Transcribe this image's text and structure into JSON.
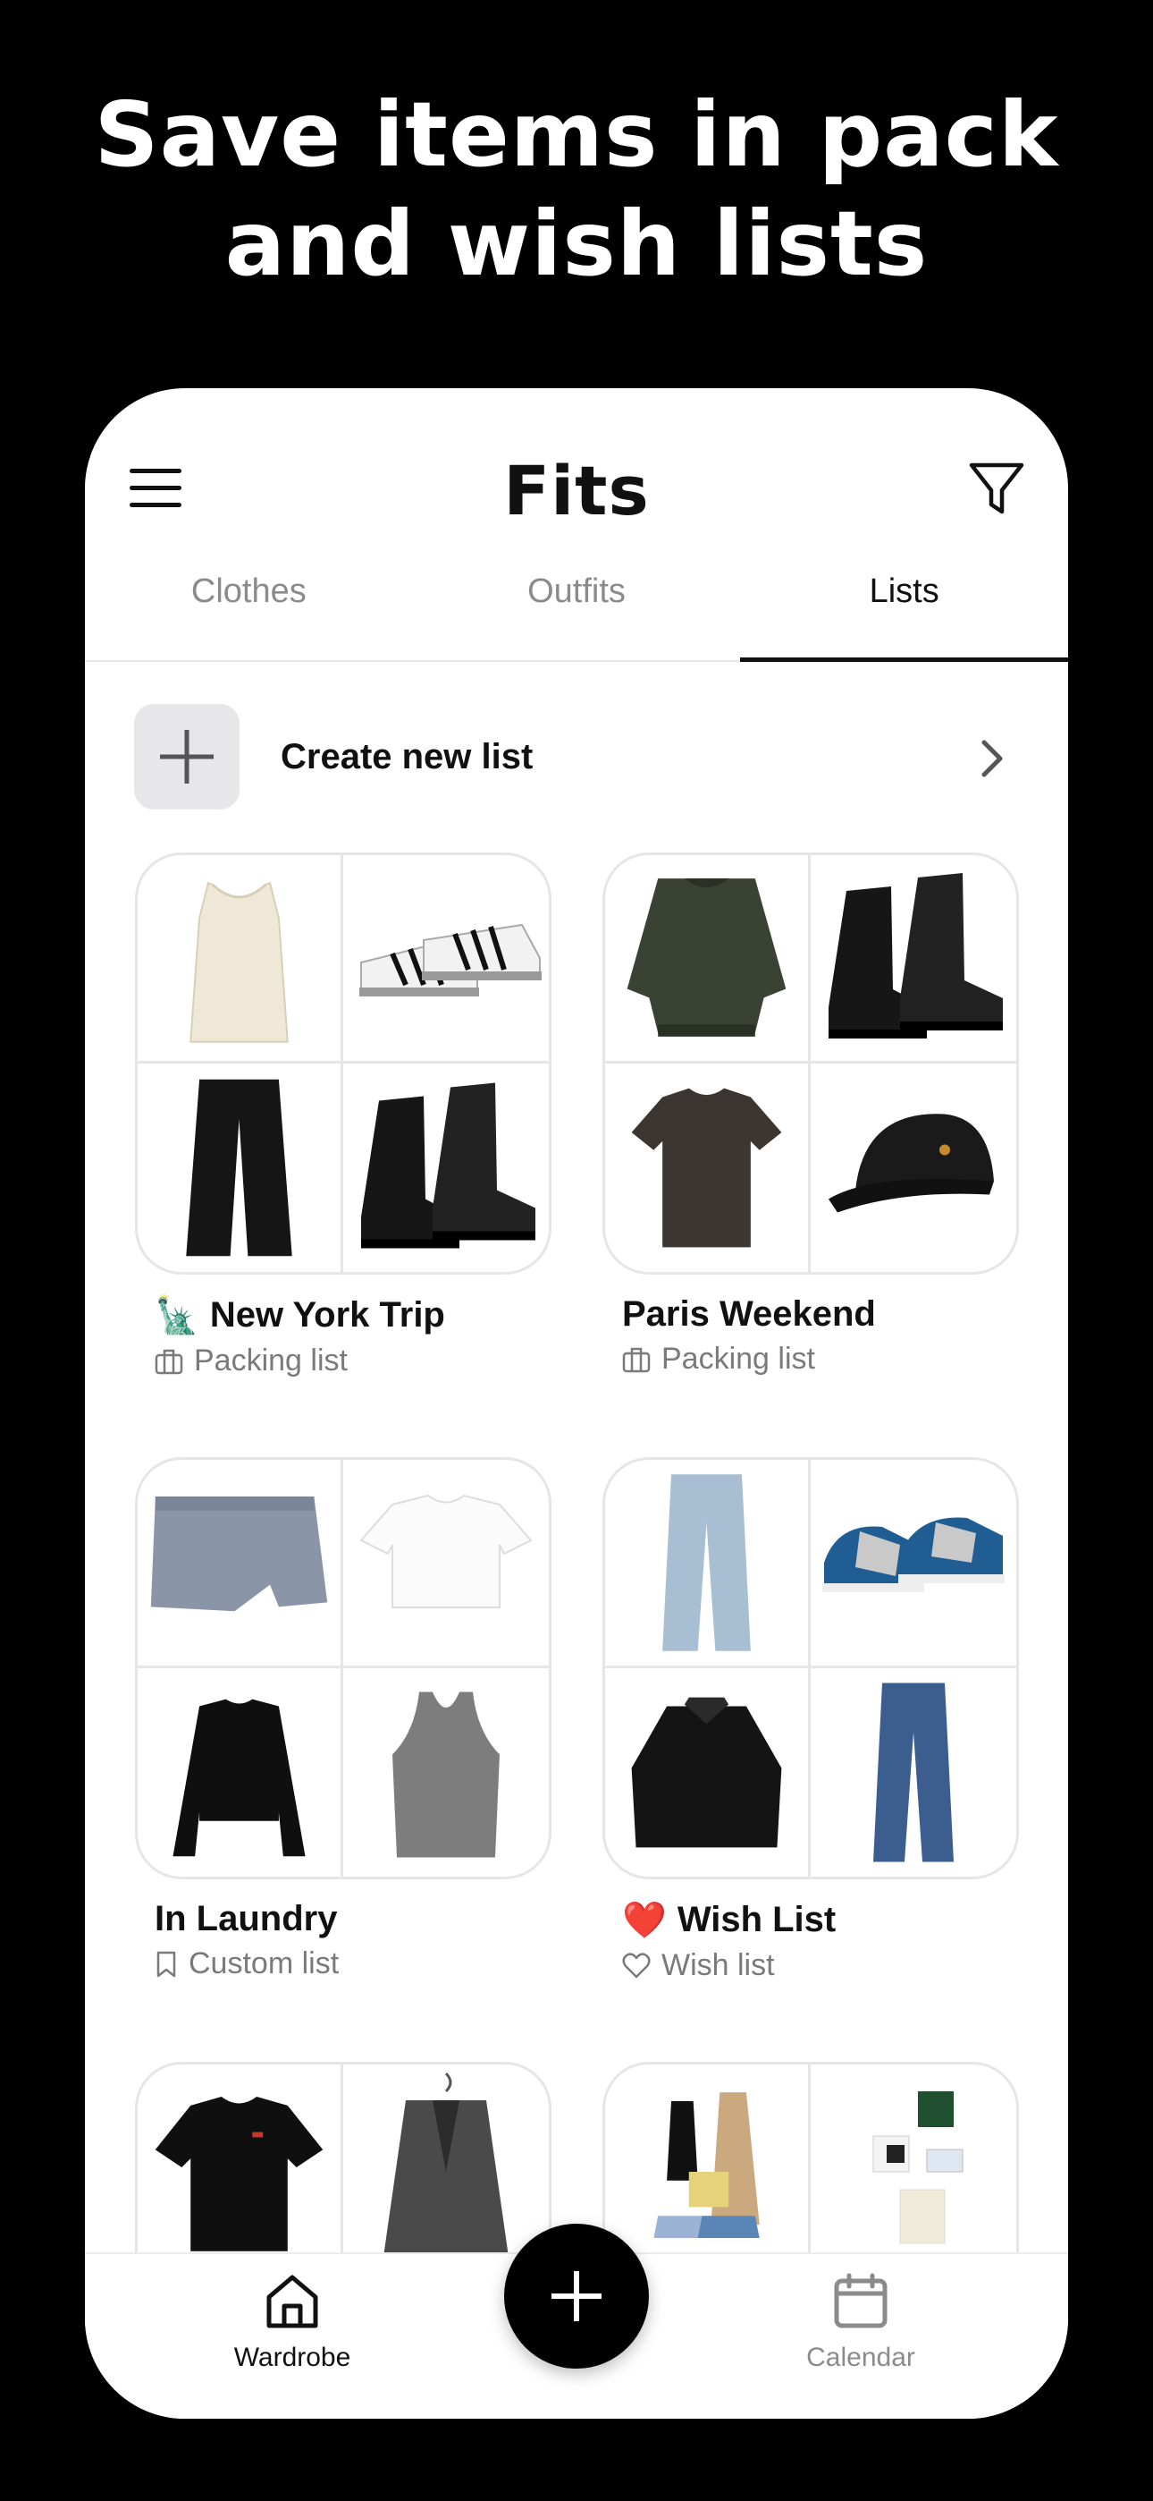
{
  "headline": {
    "line1": "Save items in pack",
    "line2": "and wish lists"
  },
  "app": {
    "title": "Fits",
    "menu_icon": "menu-icon",
    "filter_icon": "filter-icon"
  },
  "tabs": [
    {
      "label": "Clothes",
      "active": false
    },
    {
      "label": "Outfits",
      "active": false
    },
    {
      "label": "Lists",
      "active": true
    }
  ],
  "create": {
    "label": "Create new list",
    "icon": "plus-icon",
    "chevron": "chevron-right-icon"
  },
  "lists": [
    {
      "name": "New York Trip",
      "emoji": "🗽",
      "type": "Packing list",
      "type_icon": "suitcase-icon",
      "items": [
        "cream-lace-top",
        "white-black-sneakers",
        "black-leather-pants",
        "black-chelsea-boots"
      ]
    },
    {
      "name": "Paris Weekend",
      "emoji": "",
      "type": "Packing list",
      "type_icon": "suitcase-icon",
      "items": [
        "olive-bomber-jacket",
        "black-chelsea-boots",
        "brown-tshirt",
        "black-cap"
      ]
    },
    {
      "name": "In Laundry",
      "emoji": "",
      "type": "Custom list",
      "type_icon": "bookmark-icon",
      "items": [
        "denim-skort",
        "white-crop-tee",
        "black-crop-sweater",
        "grey-tank-top"
      ]
    },
    {
      "name": "Wish List",
      "emoji": "❤️",
      "type": "Wish list",
      "type_icon": "heart-icon",
      "items": [
        "light-wide-jeans",
        "blue-grey-sneakers",
        "black-short-jacket",
        "blue-straight-jeans"
      ]
    },
    {
      "name": "",
      "emoji": "",
      "type": "",
      "type_icon": "",
      "items": [
        "black-tshirt",
        "grey-blazer"
      ]
    },
    {
      "name": "",
      "emoji": "",
      "type": "",
      "type_icon": "",
      "items": [
        "outfit-collage",
        "outfit-collage-2"
      ]
    }
  ],
  "nav": {
    "wardrobe": {
      "label": "Wardrobe",
      "icon": "home-icon",
      "active": true
    },
    "add": {
      "icon": "plus-icon"
    },
    "calendar": {
      "label": "Calendar",
      "icon": "calendar-icon",
      "active": false
    }
  },
  "colors": {
    "background": "#000000",
    "surface": "#ffffff",
    "text": "#111111",
    "muted": "#7a7a7a",
    "border": "#e6e6e6"
  }
}
